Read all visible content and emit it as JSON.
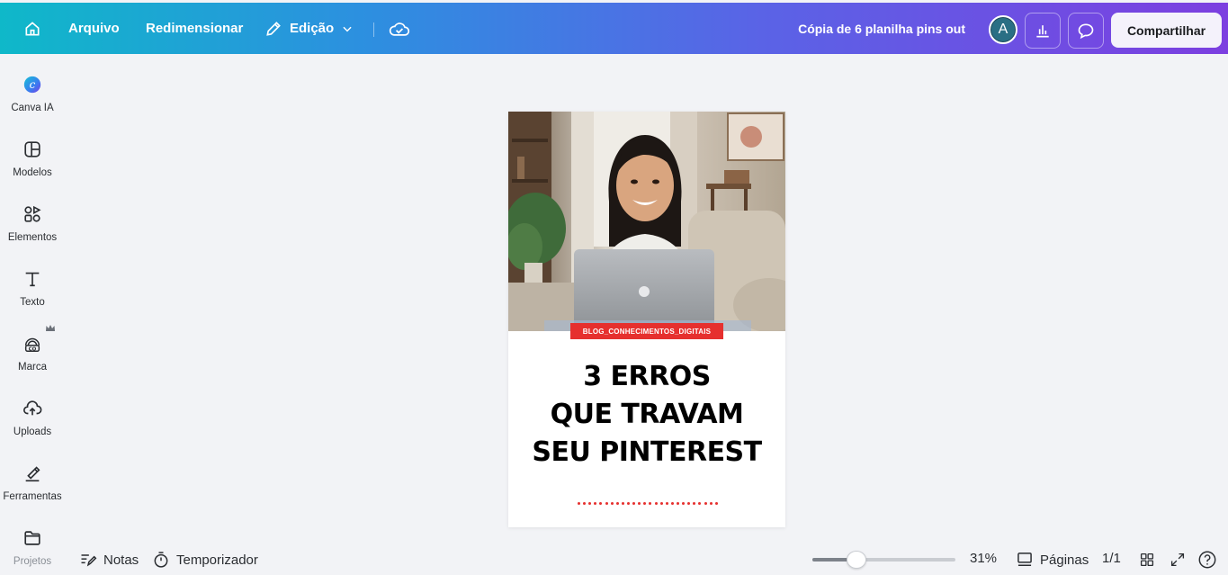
{
  "topbar": {
    "file_label": "Arquivo",
    "resize_label": "Redimensionar",
    "edit_label": "Edição",
    "doc_title": "Cópia de 6 planilha pins out",
    "avatar_initial": "A",
    "share_label": "Compartilhar",
    "icons": [
      "home-icon",
      "pencil-icon",
      "chevron-down-icon",
      "cloud-check-icon",
      "bar-chart-icon",
      "comment-icon"
    ]
  },
  "sidebar": {
    "items": [
      {
        "label": "Canva IA",
        "icon": "canva-ai-icon"
      },
      {
        "label": "Modelos",
        "icon": "templates-icon"
      },
      {
        "label": "Elementos",
        "icon": "elements-icon"
      },
      {
        "label": "Texto",
        "icon": "text-icon"
      },
      {
        "label": "Marca",
        "icon": "brand-icon"
      },
      {
        "label": "Uploads",
        "icon": "upload-icon"
      },
      {
        "label": "Ferramentas",
        "icon": "tools-icon"
      },
      {
        "label": "Projetos",
        "icon": "folder-icon"
      }
    ]
  },
  "design": {
    "tag": "BLOG_CONHECIMENTOS_DIGITAIS",
    "headline_lines": [
      "3 ERROS",
      "QUE TRAVAM",
      "SEU PINTEREST"
    ],
    "accent_color": "#e6302e"
  },
  "bottombar": {
    "notes_label": "Notas",
    "timer_label": "Temporizador",
    "zoom": "31%",
    "zoom_fraction": 0.31,
    "pages_label": "Páginas",
    "page_count": "1/1"
  }
}
